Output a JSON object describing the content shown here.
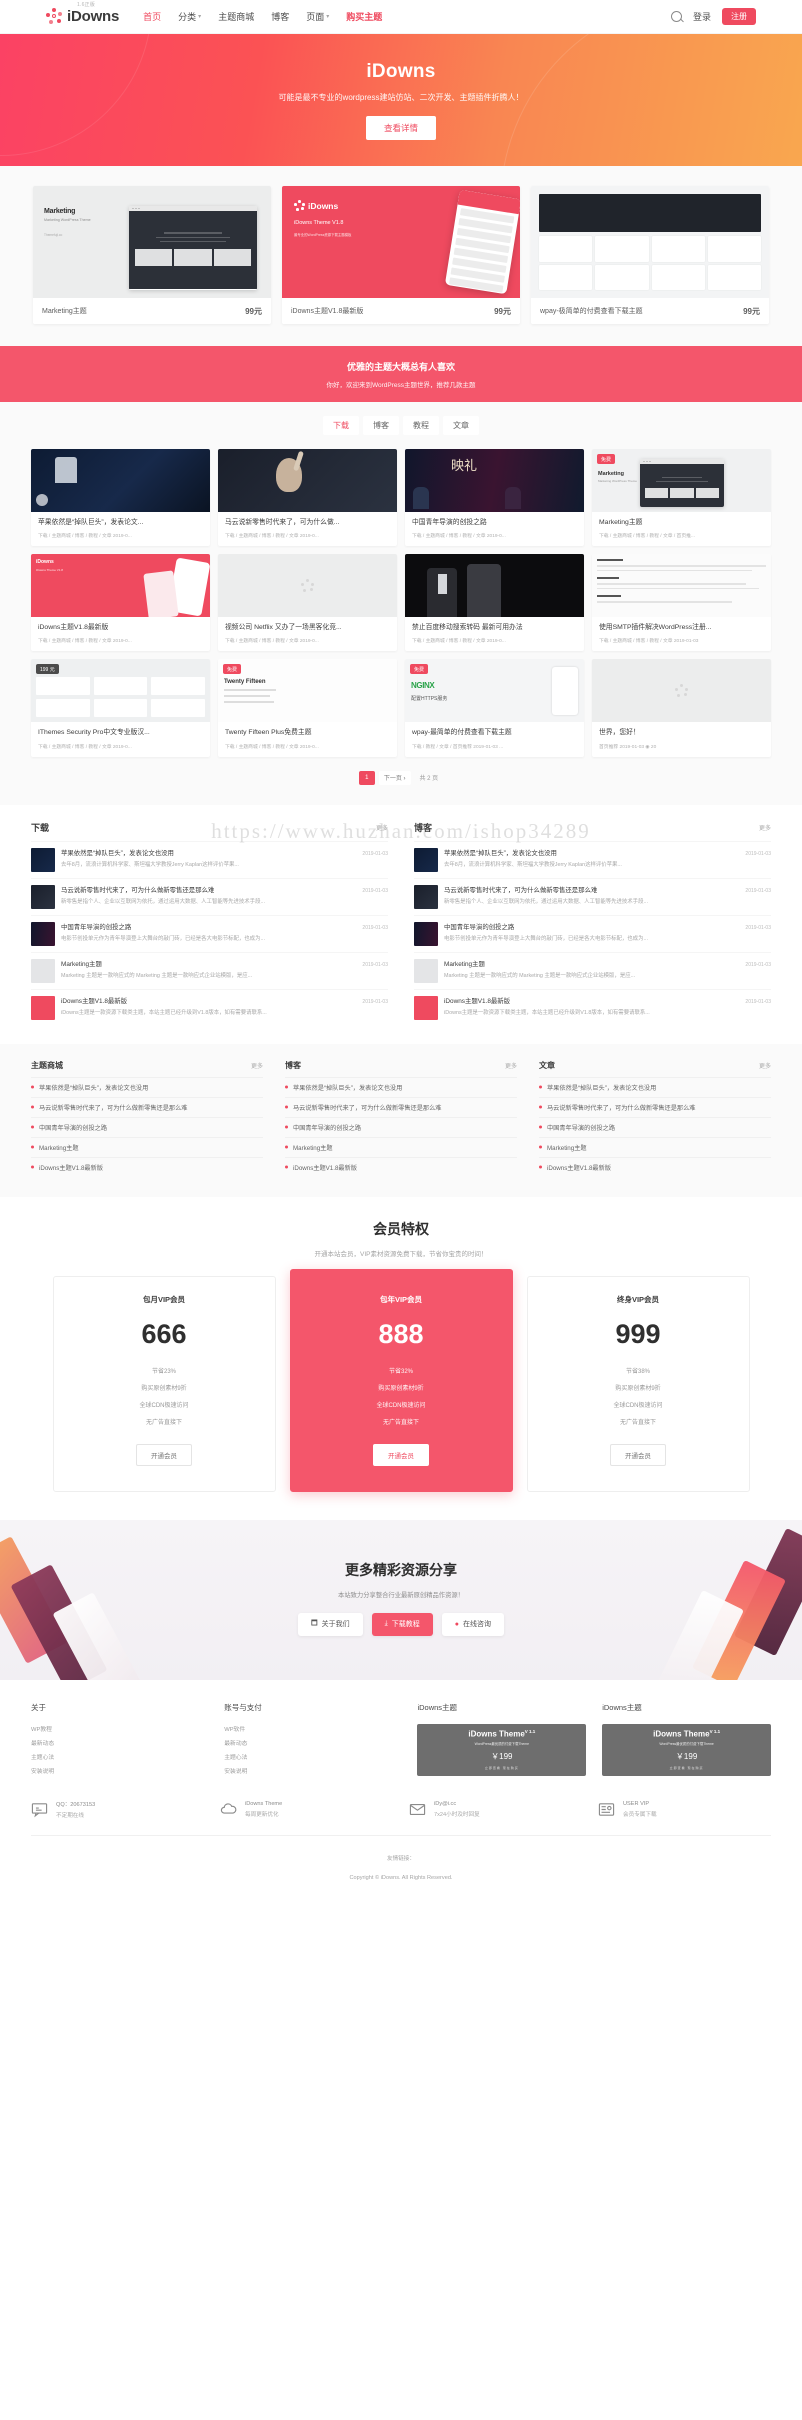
{
  "header": {
    "brand": {
      "version": "1.6正版",
      "name": "iDowns"
    },
    "nav": [
      {
        "label": "首页",
        "state": "active",
        "caret": false
      },
      {
        "label": "分类",
        "state": "normal",
        "caret": true
      },
      {
        "label": "主题商城",
        "state": "normal",
        "caret": false
      },
      {
        "label": "博客",
        "state": "normal",
        "caret": false
      },
      {
        "label": "页面",
        "state": "normal",
        "caret": true
      },
      {
        "label": "购买主题",
        "state": "buy",
        "caret": false
      }
    ],
    "search_icon": "search-icon",
    "login": "登录",
    "register": "注册"
  },
  "hero": {
    "title": "iDowns",
    "subtitle": "可能是最不专业的wordpress建站仿站、二次开发、主题插件折腾人！",
    "button": "查看详情"
  },
  "showcase": [
    {
      "name": "Marketing主题",
      "price": "99元",
      "mock_title": "Marketing",
      "mock_sub": "Marketing WordPress Theme",
      "mock_author": "Themefuji.co"
    },
    {
      "name": "iDowns主题V1.8最新版",
      "price": "99元",
      "logo": "iDowns",
      "caption": "iDowns Theme V1.8",
      "caption2": "最专业的WordPress资源下载主题模板"
    },
    {
      "name": "wpay-极简单的付费查看下载主题",
      "price": "99元"
    }
  ],
  "red_band": {
    "title": "优雅的主题大概总有人喜欢",
    "subtitle": "你好，欢迎来到WordPress主题世界，推荐几款主题"
  },
  "tabs": [
    {
      "label": "下载",
      "active": true
    },
    {
      "label": "博客",
      "active": false
    },
    {
      "label": "教程",
      "active": false
    },
    {
      "label": "文章",
      "active": false
    }
  ],
  "cards": [
    {
      "title": "苹果依然是“掉队巨头”，发表论文...",
      "meta": "下载 / 主题商城 / 博客 / 教程 / 文章   2019-0...",
      "badge": "",
      "img": "apple-dark"
    },
    {
      "title": "马云说新零售时代来了，可为什么做...",
      "meta": "下载 / 主题商城 / 博客 / 教程 / 文章   2019-0...",
      "badge": "",
      "img": "portrait-dark"
    },
    {
      "title": "中国青年导演的创投之路",
      "meta": "下载 / 主题商城 / 博客 / 教程 / 文章   2019-0...",
      "badge": "",
      "img": "stage-red"
    },
    {
      "title": "Marketing主题",
      "meta": "下载 / 主题商城 / 博客 / 教程 / 文章 / 首页推...",
      "badge": "免费",
      "badge_color": "red",
      "img": "marketing-light"
    },
    {
      "title": "iDowns主题V1.8最新版",
      "meta": "下载 / 主题商城 / 博客 / 教程 / 文章   2019-0...",
      "badge": "",
      "img": "idowns-red"
    },
    {
      "title": "视频公司 Netflix 又办了一场黑客化竞...",
      "meta": "下载 / 主题商城 / 博客 / 教程 / 文章   2019-0...",
      "badge": "",
      "img": "placeholder"
    },
    {
      "title": "禁止百度移动搜索转码 最新可用办法",
      "meta": "下载 / 主题商城 / 博客 / 教程 / 文章   2019-0...",
      "badge": "",
      "img": "suits-dark"
    },
    {
      "title": "使用SMTP插件解决WordPress注册...",
      "meta": "下载 / 主题商城 / 博客 / 教程 / 文章   2019-01-03",
      "badge": "",
      "img": "code-light"
    },
    {
      "title": "IThemes Security Pro中文专业版汉...",
      "meta": "下载 / 主题商城 / 博客 / 教程 / 文章   2019-0...",
      "badge": "199 元",
      "badge_color": "dark",
      "img": "security-light"
    },
    {
      "title": "Twenty Fifteen Plus免费主题",
      "meta": "下载 / 主题商城 / 博客 / 教程 / 文章   2019-0...",
      "badge": "免费",
      "badge_color": "red",
      "img": "nginx-light"
    },
    {
      "title": "wpay-最简单的付费查看下载主题",
      "meta": "下载 / 教程 / 文章 / 首页推荐   2019-01-03   ...",
      "badge": "免费",
      "badge_color": "red",
      "img": "gallery-light"
    },
    {
      "title": "世界，您好！",
      "meta": "首页推荐   2019-01-03   ◉ 20",
      "badge": "",
      "img": "placeholder"
    }
  ],
  "pager": {
    "pages": [
      "1"
    ],
    "next": "下一页 ›",
    "info": "共 2 页"
  },
  "watermark": "https://www.huzhan.com/ishop34289",
  "detail_lists": [
    {
      "title": "下载",
      "more": "更多",
      "items": [
        {
          "title": "苹果依然是“掉队巨头”，发表论文也没用",
          "date": "2019-01-03",
          "desc": "去年8月，流浪计算机科学家、斯坦福大学教授Jerry Kaplan这样评价苹果..."
        },
        {
          "title": "马云说新零售时代来了，可为什么做新零售还是那么难",
          "date": "2019-01-03",
          "desc": "新零售是指个人、企业以互联网为依托，通过运用大数据、人工智能等先进技术手段..."
        },
        {
          "title": "中国青年导演的创投之路",
          "date": "2019-01-03",
          "desc": "电影节创投单元作为青年导演登上大舞台的敲门砖，已经是各大电影节标配，也成为..."
        },
        {
          "title": "Marketing主题",
          "date": "2019-01-03",
          "desc": "Marketing 主题是一款响应式的 Marketing 主题是一款响应式企业站模版，是应..."
        },
        {
          "title": "iDowns主题V1.8最新版",
          "date": "2019-01-03",
          "desc": "iDowns主题是一款资源下载类主题，本站主题已经升级到V1.8版本，如有需要请联系..."
        }
      ]
    },
    {
      "title": "博客",
      "more": "更多",
      "items": [
        {
          "title": "苹果依然是“掉队巨头”，发表论文也没用",
          "date": "2019-01-03",
          "desc": "去年8月，流浪计算机科学家、斯坦福大学教授Jerry Kaplan这样评价苹果..."
        },
        {
          "title": "马云说新零售时代来了，可为什么做新零售还是那么难",
          "date": "2019-01-03",
          "desc": "新零售是指个人、企业以互联网为依托，通过运用大数据、人工智能等先进技术手段..."
        },
        {
          "title": "中国青年导演的创投之路",
          "date": "2019-01-03",
          "desc": "电影节创投单元作为青年导演登上大舞台的敲门砖，已经是各大电影节标配，也成为..."
        },
        {
          "title": "Marketing主题",
          "date": "2019-01-03",
          "desc": "Marketing 主题是一款响应式的 Marketing 主题是一款响应式企业站模版，是应..."
        },
        {
          "title": "iDowns主题V1.8最新版",
          "date": "2019-01-03",
          "desc": "iDowns主题是一款资源下载类主题，本站主题已经升级到V1.8版本，如有需要请联系..."
        }
      ]
    }
  ],
  "simple_lists": [
    {
      "title": "主题商城",
      "more": "更多",
      "items": [
        "苹果依然是“掉队巨头”，发表论文也没用",
        "马云说新零售时代来了，可为什么做新零售还是那么难",
        "中国青年导演的创投之路",
        "Marketing主题",
        "iDowns主题V1.8最新版"
      ]
    },
    {
      "title": "博客",
      "more": "更多",
      "items": [
        "苹果依然是“掉队巨头”，发表论文也没用",
        "马云说新零售时代来了，可为什么做新零售还是那么难",
        "中国青年导演的创投之路",
        "Marketing主题",
        "iDowns主题V1.8最新版"
      ]
    },
    {
      "title": "文章",
      "more": "更多",
      "items": [
        "苹果依然是“掉队巨头”，发表论文也没用",
        "马云说新零售时代来了，可为什么做新零售还是那么难",
        "中国青年导演的创投之路",
        "Marketing主题",
        "iDowns主题V1.8最新版"
      ]
    }
  ],
  "pricing": {
    "title": "会员特权",
    "subtitle": "开通本站会员，VIP素材资源免费下载，节省你宝贵的时间！",
    "plans": [
      {
        "name": "包月VIP会员",
        "amount": "666",
        "features": [
          "节省23%",
          "购买原创素材9折",
          "全球CDN极速访问",
          "无广告直接下"
        ],
        "button": "开通会员",
        "featured": false
      },
      {
        "name": "包年VIP会员",
        "amount": "888",
        "features": [
          "节省32%",
          "购买原创素材9折",
          "全球CDN极速访问",
          "无广告直接下"
        ],
        "button": "开通会员",
        "featured": true
      },
      {
        "name": "终身VIP会员",
        "amount": "999",
        "features": [
          "节省38%",
          "购买原创素材9折",
          "全球CDN极速访问",
          "无广告直接下"
        ],
        "button": "开通会员",
        "featured": false
      }
    ]
  },
  "cta": {
    "title": "更多精彩资源分享",
    "subtitle": "本站致力分享整合行业最新原创精品作资源！",
    "buttons": [
      {
        "label": "关于我们",
        "icon": "window-icon",
        "primary": false
      },
      {
        "label": "下载教程",
        "icon": "download-icon",
        "primary": true
      },
      {
        "label": "在线咨询",
        "icon": "chat-icon",
        "primary": false
      }
    ]
  },
  "footer": {
    "columns": [
      {
        "title": "关于",
        "links": [
          "WP教程",
          "最新动态",
          "主题心法",
          "安装说明"
        ]
      },
      {
        "title": "账号与支付",
        "links": [
          "WP软件",
          "最新动态",
          "主题心法",
          "安装说明"
        ]
      }
    ],
    "ads": [
      {
        "title": "iDowns主题",
        "name": "iDowns Theme",
        "ver": "V 1.1",
        "sub": "WordPress最优质的付费下载Theme",
        "price": "￥199",
        "dots": "立即查看 现在购买"
      },
      {
        "title": "iDowns主题",
        "name": "iDowns Theme",
        "ver": "V 1.1",
        "sub": "WordPress最优质的付费下载Theme",
        "price": "￥199",
        "dots": "立即查看 现在购买"
      }
    ],
    "services": [
      {
        "icon": "chat-bubble-icon",
        "a": "QQ：20673153",
        "b": "不定期在线"
      },
      {
        "icon": "cloud-icon",
        "a": "iDowns Theme",
        "b": "每周更新优化"
      },
      {
        "icon": "envelope-icon",
        "a": "iDy@i.cc",
        "b": "7x24小时及时回复"
      },
      {
        "icon": "id-card-icon",
        "a": "USER VIP",
        "b": "会员专属下载"
      }
    ],
    "friend_links": "友情链接：",
    "copyright": "Copyright © iDowns. All Rights Reserved."
  }
}
